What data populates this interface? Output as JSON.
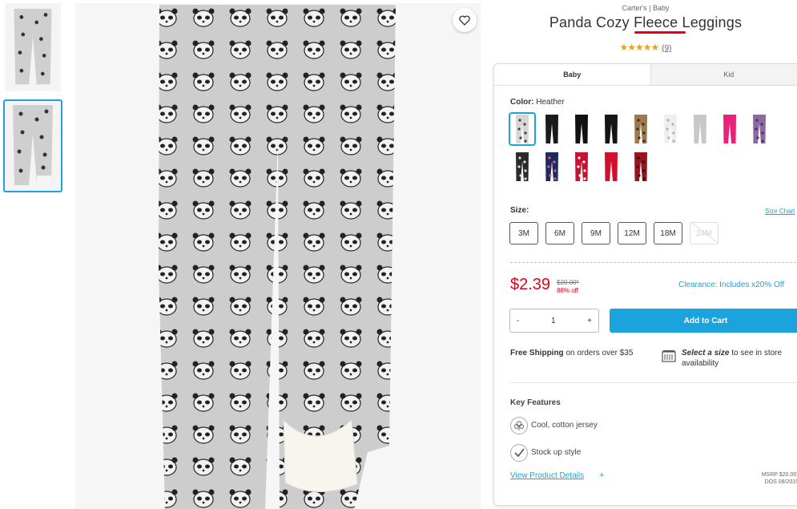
{
  "product": {
    "brand": "Carter's | Baby",
    "title": "Panda Cozy Fleece Leggings",
    "rating_stars": "★★★★★",
    "review_count": "(9)"
  },
  "tabs": [
    "Baby",
    "Kid"
  ],
  "color": {
    "label": "Color:",
    "selected": "Heather",
    "swatches": [
      {
        "name": "heather-panda",
        "fill": "#d6d6d6",
        "pattern": "#444444"
      },
      {
        "name": "black",
        "fill": "#1a1a1a"
      },
      {
        "name": "black-2",
        "fill": "#111111"
      },
      {
        "name": "black-3",
        "fill": "#151515"
      },
      {
        "name": "leopard",
        "fill": "#9a7a4e",
        "pattern": "#3d2b17"
      },
      {
        "name": "white-print",
        "fill": "#eeeeee",
        "pattern": "#b8a8d0"
      },
      {
        "name": "gray",
        "fill": "#c8c8c8"
      },
      {
        "name": "pink",
        "fill": "#e8217a"
      },
      {
        "name": "purple-print",
        "fill": "#8c6aa0",
        "pattern": "#4b3060"
      },
      {
        "name": "black-star",
        "fill": "#2a2a2a",
        "pattern": "#dddddd"
      },
      {
        "name": "navy-star",
        "fill": "#1d2a5c",
        "pattern": "#e35a8a"
      },
      {
        "name": "red-print",
        "fill": "#c41230",
        "pattern": "#ffffff"
      },
      {
        "name": "red",
        "fill": "#d2102e"
      },
      {
        "name": "red-plaid",
        "fill": "#9a1420",
        "pattern": "#1a1a1a"
      }
    ]
  },
  "size": {
    "label": "Size:",
    "chart_link": "Size Chart",
    "options": [
      "3M",
      "6M",
      "9M",
      "12M",
      "18M",
      "24M"
    ],
    "disabled": "24M"
  },
  "pricing": {
    "price": "$2.39",
    "original": "$20.00*",
    "percent_off": "88% off",
    "clearance": "Clearance: Includes x20% Off"
  },
  "cart": {
    "minus": "-",
    "quantity": "1",
    "plus": "+",
    "add_label": "Add to Cart"
  },
  "shipping": {
    "bold": "Free Shipping",
    "rest": " on orders over $35"
  },
  "store": {
    "bold": "Select a size",
    "rest": " to see in store availability"
  },
  "key_features": {
    "title": "Key Features",
    "items": [
      "Cool, cotton jersey",
      "Stock up style"
    ]
  },
  "details_link": "View Product Details",
  "details_plus": "+",
  "msrp": {
    "line1": "MSRP $20.00*",
    "line2": "DOS 08/2019"
  },
  "colors": {
    "accent": "#1aa3dc",
    "sale_red": "#e2001a",
    "star": "#e8a11a"
  }
}
